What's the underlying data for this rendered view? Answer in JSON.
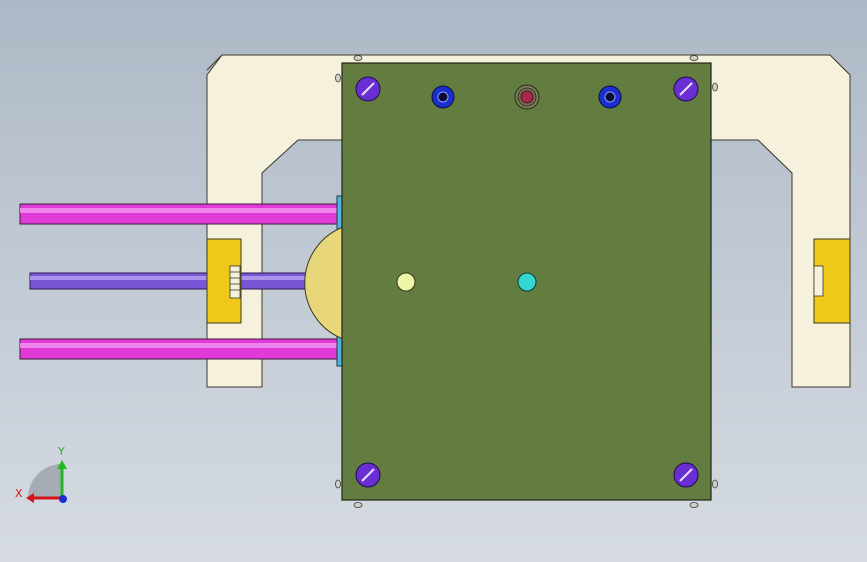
{
  "viewport": {
    "background_top": "#aeb8c6",
    "background_bottom": "#d6dbe2"
  },
  "model": {
    "frame_color": "#f6f1dc",
    "plate_color": "#637c40",
    "rod_magenta": "#e23ad8",
    "rod_violet": "#7a56d6",
    "clamp_yellow": "#f0c81a",
    "screw_purple": "#6a2fd2",
    "bushing_blue": "#1b2fd0",
    "center_pin_red": "#a8274a",
    "pin_light_yellow": "#ecf6a6",
    "pin_cyan": "#34d6d0",
    "half_disc_yellow": "#e8d77a"
  },
  "triad": {
    "x_label": "X",
    "y_label": "Y",
    "x_color": "#d4141a",
    "y_color": "#22b822",
    "z_color": "#1a2ad6",
    "icon": "coordinate-triad-icon"
  }
}
